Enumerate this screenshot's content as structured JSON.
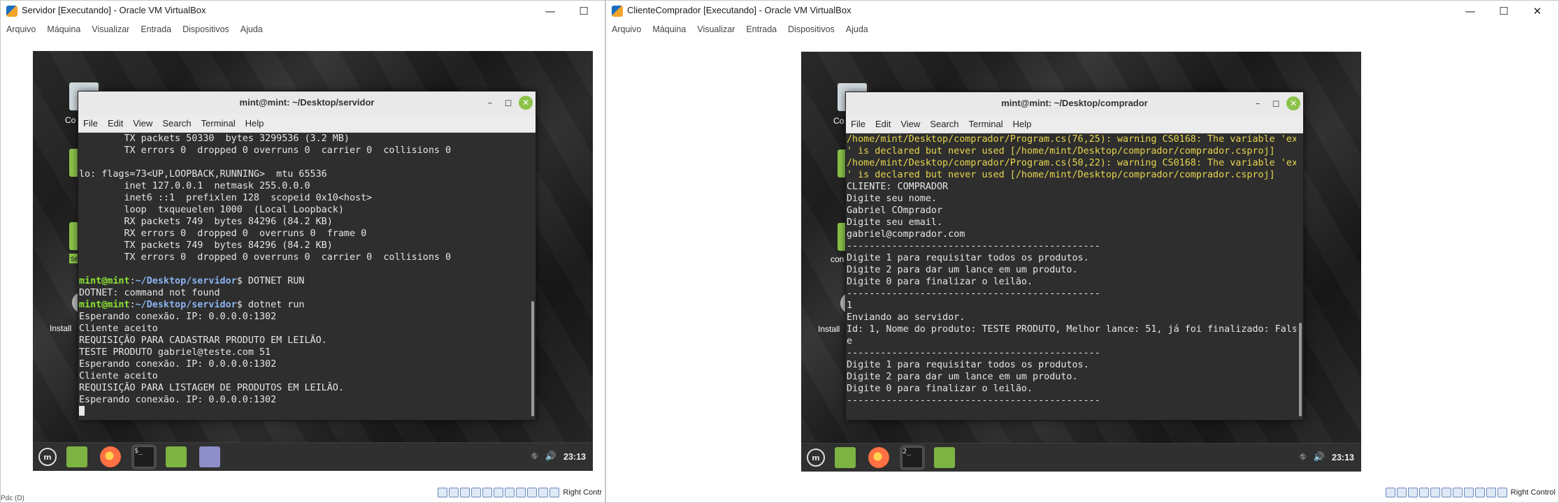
{
  "left_window": {
    "title": "Servidor [Executando] - Oracle VM VirtualBox",
    "menu": [
      "Arquivo",
      "Máquina",
      "Visualizar",
      "Entrada",
      "Dispositivos",
      "Ajuda"
    ],
    "desktop_labels": [
      "Co",
      "se",
      "Install"
    ],
    "terminal": {
      "title": "mint@mint: ~/Desktop/servidor",
      "menu": [
        "File",
        "Edit",
        "View",
        "Search",
        "Terminal",
        "Help"
      ],
      "lines": [
        {
          "text": "        TX packets 50330  bytes 3299536 (3.2 MB)"
        },
        {
          "text": "        TX errors 0  dropped 0 overruns 0  carrier 0  collisions 0"
        },
        {
          "text": ""
        },
        {
          "text": "lo: flags=73<UP,LOOPBACK,RUNNING>  mtu 65536"
        },
        {
          "text": "        inet 127.0.0.1  netmask 255.0.0.0"
        },
        {
          "text": "        inet6 ::1  prefixlen 128  scopeid 0x10<host>"
        },
        {
          "text": "        loop  txqueuelen 1000  (Local Loopback)"
        },
        {
          "text": "        RX packets 749  bytes 84296 (84.2 KB)"
        },
        {
          "text": "        RX errors 0  dropped 0  overruns 0  frame 0"
        },
        {
          "text": "        TX packets 749  bytes 84296 (84.2 KB)"
        },
        {
          "text": "        TX errors 0  dropped 0 overruns 0  carrier 0  collisions 0"
        },
        {
          "text": ""
        },
        {
          "prompt_user": "mint@mint",
          "prompt_path": "~/Desktop/servidor",
          "command": "$ DOTNET RUN"
        },
        {
          "text": "DOTNET: command not found"
        },
        {
          "prompt_user": "mint@mint",
          "prompt_path": "~/Desktop/servidor",
          "command": "$ dotnet run"
        },
        {
          "text": "Esperando conexão. IP: 0.0.0.0:1302"
        },
        {
          "text": "Cliente aceito"
        },
        {
          "text": "REQUISIÇÃO PARA CADASTRAR PRODUTO EM LEILÃO."
        },
        {
          "text": "TESTE PRODUTO gabriel@teste.com 51"
        },
        {
          "text": "Esperando conexão. IP: 0.0.0.0:1302"
        },
        {
          "text": "Cliente aceito"
        },
        {
          "text": "REQUISIÇÃO PARA LISTAGEM DE PRODUTOS EM LEILÃO."
        },
        {
          "text": "Esperando conexão. IP: 0.0.0.0:1302"
        },
        {
          "text": "",
          "cursor": true
        }
      ]
    },
    "panel_clock": "23:13",
    "status_text": "Right Contr",
    "bottom_left": "Pdc (D)"
  },
  "right_window": {
    "title": "ClienteComprador [Executando] - Oracle VM VirtualBox",
    "menu": [
      "Arquivo",
      "Máquina",
      "Visualizar",
      "Entrada",
      "Dispositivos",
      "Ajuda"
    ],
    "desktop_labels": [
      "Co",
      "con",
      "Install"
    ],
    "terminal": {
      "title": "mint@mint: ~/Desktop/comprador",
      "menu": [
        "File",
        "Edit",
        "View",
        "Search",
        "Terminal",
        "Help"
      ],
      "lines": [
        {
          "text": "/home/mint/Desktop/comprador/Program.cs(76,25): warning CS0168: The variable 'ex",
          "warn": true
        },
        {
          "text": "' is declared but never used [/home/mint/Desktop/comprador/comprador.csproj]",
          "warn": true
        },
        {
          "text": "/home/mint/Desktop/comprador/Program.cs(50,22): warning CS0168: The variable 'ex",
          "warn": true
        },
        {
          "text": "' is declared but never used [/home/mint/Desktop/comprador/comprador.csproj]",
          "warn": true
        },
        {
          "text": "CLIENTE: COMPRADOR"
        },
        {
          "text": "Digite seu nome."
        },
        {
          "text": "Gabriel COmprador"
        },
        {
          "text": "Digite seu email."
        },
        {
          "text": "gabriel@comprador.com"
        },
        {
          "text": "---------------------------------------------"
        },
        {
          "text": "Digite 1 para requisitar todos os produtos."
        },
        {
          "text": "Digite 2 para dar um lance em um produto."
        },
        {
          "text": "Digite 0 para finalizar o leilão."
        },
        {
          "text": "---------------------------------------------"
        },
        {
          "text": "1"
        },
        {
          "text": "Enviando ao servidor."
        },
        {
          "text": "Id: 1, Nome do produto: TESTE PRODUTO, Melhor lance: 51, já foi finalizado: Fals"
        },
        {
          "text": "e"
        },
        {
          "text": "---------------------------------------------"
        },
        {
          "text": "Digite 1 para requisitar todos os produtos."
        },
        {
          "text": "Digite 2 para dar um lance em um produto."
        },
        {
          "text": "Digite 0 para finalizar o leilão."
        },
        {
          "text": "---------------------------------------------"
        }
      ]
    },
    "panel_clock": "23:13",
    "status_text": "Right Control"
  }
}
